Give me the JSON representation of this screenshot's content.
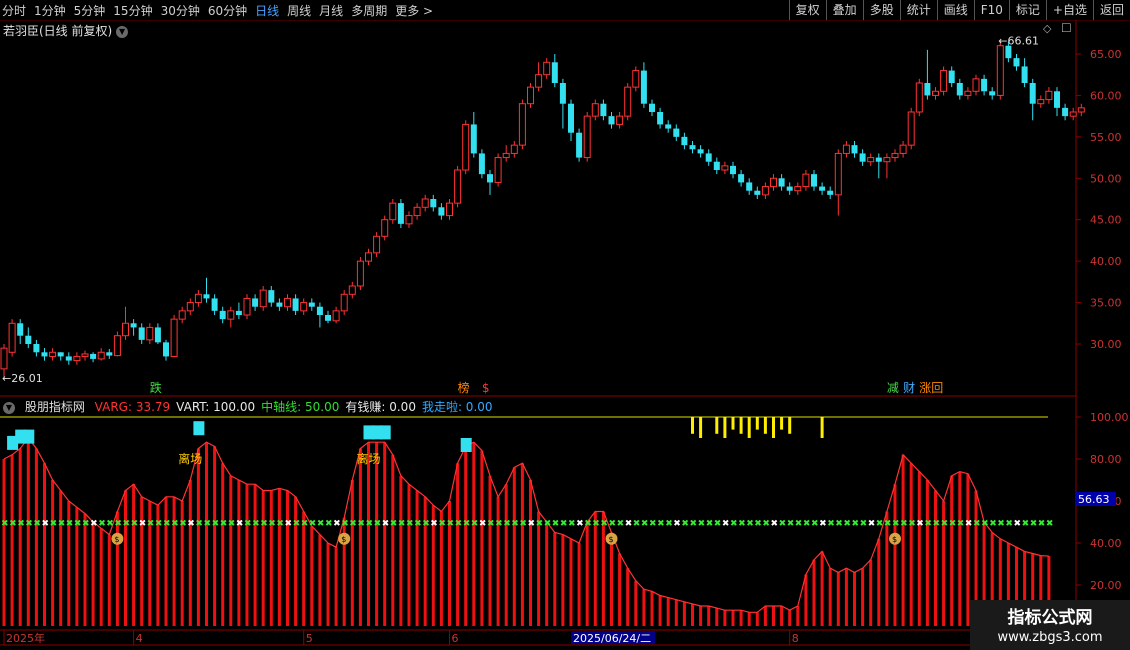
{
  "toolbar": {
    "periods": [
      "分时",
      "1分钟",
      "5分钟",
      "15分钟",
      "30分钟",
      "60分钟",
      "日线",
      "周线",
      "月线",
      "多周期",
      "更多 >"
    ],
    "active_period": "日线",
    "tools": [
      "复权",
      "叠加",
      "多股",
      "统计",
      "画线",
      "F10",
      "标记",
      "+自选",
      "返回"
    ]
  },
  "main": {
    "title": "若羽臣(日线 前复权)",
    "dropdown_icon": "chevron-down-icon",
    "price_labels": [
      "65.00",
      "60.00",
      "55.00",
      "50.00",
      "45.00",
      "40.00",
      "35.00",
      "30.00"
    ],
    "high_label": "66.61",
    "low_label": "26.01",
    "signals": [
      {
        "text": "跌",
        "color": "#44dd44",
        "col": 18
      },
      {
        "text": "榜",
        "color": "#ff8800",
        "col": 56
      },
      {
        "text": "$",
        "color": "#ff3333",
        "col": 59
      },
      {
        "text": "减",
        "color": "#44dd44",
        "col": 109
      },
      {
        "text": "财",
        "color": "#44aaff",
        "col": 111
      },
      {
        "text": "涨回",
        "color": "#ff8800",
        "col": 113
      }
    ]
  },
  "indicator": {
    "title": "股朋指标网",
    "fields": [
      {
        "label": "VARG: 33.79",
        "color": "#ff3333"
      },
      {
        "label": "VART: 100.00",
        "color": "#e8e8e8"
      },
      {
        "label": "中轴线: 50.00",
        "color": "#33dd33"
      },
      {
        "label": "有钱赚: 0.00",
        "color": "#e8e8e8"
      },
      {
        "label": "我走啦: 0.00",
        "color": "#33aaff"
      }
    ],
    "axis_labels": [
      "100.00",
      "80.00",
      "60.00",
      "40.00",
      "20.00"
    ],
    "current_value": "56.63",
    "exit_label": "离场",
    "exit_cols": [
      23,
      45
    ],
    "money_cols": [
      14,
      42,
      75,
      110
    ]
  },
  "date_axis": {
    "labels": [
      {
        "text": "2025年",
        "col": 0
      },
      {
        "text": "4",
        "col": 16
      },
      {
        "text": "5",
        "col": 37
      },
      {
        "text": "6",
        "col": 55
      },
      {
        "text": "8",
        "col": 97
      }
    ],
    "cursor_date": "2025/06/24/二",
    "cursor_col": 70
  },
  "watermark": {
    "title": "指标公式网",
    "url": "www.zbgs3.com"
  },
  "chart_data": {
    "type": "candlestick",
    "title": "若羽臣(日线 前复权)",
    "price_range": [
      24,
      68
    ],
    "candles": [
      {
        "o": 27,
        "c": 29.5,
        "h": 30,
        "l": 26
      },
      {
        "o": 29,
        "c": 32.5,
        "h": 33,
        "l": 28.5
      },
      {
        "o": 32.5,
        "c": 31,
        "h": 33,
        "l": 30
      },
      {
        "o": 31,
        "c": 30,
        "h": 32,
        "l": 29.5
      },
      {
        "o": 30,
        "c": 29,
        "h": 30.5,
        "l": 28.5
      },
      {
        "o": 29,
        "c": 28.5,
        "h": 29.5,
        "l": 28
      },
      {
        "o": 28.5,
        "c": 29,
        "h": 29.5,
        "l": 28
      },
      {
        "o": 29,
        "c": 28.5,
        "h": 29,
        "l": 28
      },
      {
        "o": 28.5,
        "c": 28,
        "h": 29,
        "l": 27.5
      },
      {
        "o": 28,
        "c": 28.5,
        "h": 29,
        "l": 27.5
      },
      {
        "o": 28.5,
        "c": 28.8,
        "h": 29.2,
        "l": 28
      },
      {
        "o": 28.8,
        "c": 28.2,
        "h": 29,
        "l": 27.8
      },
      {
        "o": 28.2,
        "c": 29,
        "h": 29.5,
        "l": 28
      },
      {
        "o": 29,
        "c": 28.6,
        "h": 29.4,
        "l": 28.2
      },
      {
        "o": 28.6,
        "c": 31,
        "h": 31.5,
        "l": 28.5
      },
      {
        "o": 31,
        "c": 32.5,
        "h": 34.5,
        "l": 30.5
      },
      {
        "o": 32.5,
        "c": 32,
        "h": 33,
        "l": 31
      },
      {
        "o": 32,
        "c": 30.5,
        "h": 32.5,
        "l": 30
      },
      {
        "o": 30.5,
        "c": 32,
        "h": 32.5,
        "l": 30
      },
      {
        "o": 32,
        "c": 30.2,
        "h": 32.5,
        "l": 30
      },
      {
        "o": 30.2,
        "c": 28.5,
        "h": 30.5,
        "l": 28
      },
      {
        "o": 28.5,
        "c": 33,
        "h": 33.5,
        "l": 28.5
      },
      {
        "o": 33,
        "c": 34,
        "h": 34.5,
        "l": 32.5
      },
      {
        "o": 34,
        "c": 35,
        "h": 35.5,
        "l": 33.5
      },
      {
        "o": 35,
        "c": 36,
        "h": 36.5,
        "l": 34.5
      },
      {
        "o": 36,
        "c": 35.5,
        "h": 38,
        "l": 35
      },
      {
        "o": 35.5,
        "c": 34,
        "h": 36,
        "l": 33.5
      },
      {
        "o": 34,
        "c": 33,
        "h": 34.5,
        "l": 32.5
      },
      {
        "o": 33,
        "c": 34,
        "h": 34.5,
        "l": 32
      },
      {
        "o": 34,
        "c": 33.5,
        "h": 35,
        "l": 33
      },
      {
        "o": 33.5,
        "c": 35.5,
        "h": 36,
        "l": 33
      },
      {
        "o": 35.5,
        "c": 34.5,
        "h": 36,
        "l": 34
      },
      {
        "o": 34.5,
        "c": 36.5,
        "h": 37,
        "l": 34
      },
      {
        "o": 36.5,
        "c": 35,
        "h": 37,
        "l": 34.5
      },
      {
        "o": 35,
        "c": 34.5,
        "h": 35.5,
        "l": 34
      },
      {
        "o": 34.5,
        "c": 35.5,
        "h": 36,
        "l": 34
      },
      {
        "o": 35.5,
        "c": 34,
        "h": 36,
        "l": 33.5
      },
      {
        "o": 34,
        "c": 35,
        "h": 35.5,
        "l": 33.5
      },
      {
        "o": 35,
        "c": 34.5,
        "h": 35.5,
        "l": 34
      },
      {
        "o": 34.5,
        "c": 33.5,
        "h": 35,
        "l": 32
      },
      {
        "o": 33.5,
        "c": 32.8,
        "h": 34,
        "l": 32.5
      },
      {
        "o": 32.8,
        "c": 34,
        "h": 34.5,
        "l": 32.5
      },
      {
        "o": 34,
        "c": 36,
        "h": 36.5,
        "l": 33.5
      },
      {
        "o": 36,
        "c": 37,
        "h": 37.5,
        "l": 35.5
      },
      {
        "o": 37,
        "c": 40,
        "h": 40.5,
        "l": 36.5
      },
      {
        "o": 40,
        "c": 41,
        "h": 41.5,
        "l": 39.5
      },
      {
        "o": 41,
        "c": 43,
        "h": 43.5,
        "l": 40.5
      },
      {
        "o": 43,
        "c": 45,
        "h": 45.5,
        "l": 42.5
      },
      {
        "o": 45,
        "c": 47,
        "h": 47.5,
        "l": 44.5
      },
      {
        "o": 47,
        "c": 44.5,
        "h": 47.5,
        "l": 44
      },
      {
        "o": 44.5,
        "c": 45.5,
        "h": 46,
        "l": 44
      },
      {
        "o": 45.5,
        "c": 46.5,
        "h": 47,
        "l": 45
      },
      {
        "o": 46.5,
        "c": 47.5,
        "h": 48,
        "l": 46
      },
      {
        "o": 47.5,
        "c": 46.5,
        "h": 48,
        "l": 46
      },
      {
        "o": 46.5,
        "c": 45.5,
        "h": 47,
        "l": 45
      },
      {
        "o": 45.5,
        "c": 47,
        "h": 47.5,
        "l": 45
      },
      {
        "o": 47,
        "c": 51,
        "h": 51.5,
        "l": 46.5
      },
      {
        "o": 51,
        "c": 56.5,
        "h": 57,
        "l": 50.5
      },
      {
        "o": 56.5,
        "c": 53,
        "h": 58,
        "l": 52.5
      },
      {
        "o": 53,
        "c": 50.5,
        "h": 53.5,
        "l": 50
      },
      {
        "o": 50.5,
        "c": 49.5,
        "h": 51,
        "l": 48
      },
      {
        "o": 49.5,
        "c": 52.5,
        "h": 53,
        "l": 49
      },
      {
        "o": 52.5,
        "c": 53,
        "h": 54,
        "l": 52
      },
      {
        "o": 53,
        "c": 54,
        "h": 54.5,
        "l": 52.5
      },
      {
        "o": 54,
        "c": 59,
        "h": 59.5,
        "l": 53.5
      },
      {
        "o": 59,
        "c": 61,
        "h": 61.5,
        "l": 58.5
      },
      {
        "o": 61,
        "c": 62.5,
        "h": 64,
        "l": 60.5
      },
      {
        "o": 62.5,
        "c": 64,
        "h": 64.5,
        "l": 62
      },
      {
        "o": 64,
        "c": 61.5,
        "h": 65,
        "l": 61
      },
      {
        "o": 61.5,
        "c": 59,
        "h": 62,
        "l": 56
      },
      {
        "o": 59,
        "c": 55.5,
        "h": 59.5,
        "l": 54.5
      },
      {
        "o": 55.5,
        "c": 52.5,
        "h": 56,
        "l": 52
      },
      {
        "o": 52.5,
        "c": 57.5,
        "h": 58,
        "l": 52
      },
      {
        "o": 57.5,
        "c": 59,
        "h": 59.5,
        "l": 57
      },
      {
        "o": 59,
        "c": 57.5,
        "h": 59.5,
        "l": 57
      },
      {
        "o": 57.5,
        "c": 56.5,
        "h": 58,
        "l": 56
      },
      {
        "o": 56.5,
        "c": 57.5,
        "h": 58,
        "l": 56
      },
      {
        "o": 57.5,
        "c": 61,
        "h": 61.5,
        "l": 57
      },
      {
        "o": 61,
        "c": 63,
        "h": 63.5,
        "l": 60.5
      },
      {
        "o": 63,
        "c": 59,
        "h": 64,
        "l": 58.5
      },
      {
        "o": 59,
        "c": 58,
        "h": 59.5,
        "l": 57.5
      },
      {
        "o": 58,
        "c": 56.5,
        "h": 58.5,
        "l": 56
      },
      {
        "o": 56.5,
        "c": 56,
        "h": 57,
        "l": 55.5
      },
      {
        "o": 56,
        "c": 55,
        "h": 56.5,
        "l": 54.5
      },
      {
        "o": 55,
        "c": 54,
        "h": 55.5,
        "l": 53.5
      },
      {
        "o": 54,
        "c": 53.5,
        "h": 54.5,
        "l": 53
      },
      {
        "o": 53.5,
        "c": 53,
        "h": 54,
        "l": 52.5
      },
      {
        "o": 53,
        "c": 52,
        "h": 53.5,
        "l": 51.5
      },
      {
        "o": 52,
        "c": 51,
        "h": 52.5,
        "l": 50.5
      },
      {
        "o": 51,
        "c": 51.5,
        "h": 52,
        "l": 50.5
      },
      {
        "o": 51.5,
        "c": 50.5,
        "h": 52,
        "l": 50
      },
      {
        "o": 50.5,
        "c": 49.5,
        "h": 51,
        "l": 49
      },
      {
        "o": 49.5,
        "c": 48.5,
        "h": 50,
        "l": 48
      },
      {
        "o": 48.5,
        "c": 48,
        "h": 49,
        "l": 47.5
      },
      {
        "o": 48,
        "c": 49,
        "h": 49.5,
        "l": 47.5
      },
      {
        "o": 49,
        "c": 50,
        "h": 50.5,
        "l": 48.5
      },
      {
        "o": 50,
        "c": 49,
        "h": 50.5,
        "l": 48.5
      },
      {
        "o": 49,
        "c": 48.5,
        "h": 49.5,
        "l": 48
      },
      {
        "o": 48.5,
        "c": 49,
        "h": 49.5,
        "l": 48
      },
      {
        "o": 49,
        "c": 50.5,
        "h": 51,
        "l": 48.5
      },
      {
        "o": 50.5,
        "c": 49,
        "h": 51,
        "l": 48.5
      },
      {
        "o": 49,
        "c": 48.5,
        "h": 49.5,
        "l": 48
      },
      {
        "o": 48.5,
        "c": 48,
        "h": 49,
        "l": 47.5
      },
      {
        "o": 48,
        "c": 53,
        "h": 53.5,
        "l": 45.5
      },
      {
        "o": 53,
        "c": 54,
        "h": 54.5,
        "l": 52.5
      },
      {
        "o": 54,
        "c": 53,
        "h": 54.5,
        "l": 52.5
      },
      {
        "o": 53,
        "c": 52,
        "h": 53.5,
        "l": 51.5
      },
      {
        "o": 52,
        "c": 52.5,
        "h": 53,
        "l": 51.5
      },
      {
        "o": 52.5,
        "c": 52,
        "h": 53,
        "l": 50
      },
      {
        "o": 52,
        "c": 52.5,
        "h": 53,
        "l": 50
      },
      {
        "o": 52.5,
        "c": 53,
        "h": 53.5,
        "l": 52
      },
      {
        "o": 53,
        "c": 54,
        "h": 54.5,
        "l": 52.5
      },
      {
        "o": 54,
        "c": 58,
        "h": 58.5,
        "l": 53.5
      },
      {
        "o": 58,
        "c": 61.5,
        "h": 62,
        "l": 57.5
      },
      {
        "o": 61.5,
        "c": 60,
        "h": 65.5,
        "l": 59.5
      },
      {
        "o": 60,
        "c": 60.5,
        "h": 61,
        "l": 59.5
      },
      {
        "o": 60.5,
        "c": 63,
        "h": 63.5,
        "l": 60
      },
      {
        "o": 63,
        "c": 61.5,
        "h": 63.5,
        "l": 61
      },
      {
        "o": 61.5,
        "c": 60,
        "h": 62,
        "l": 59.5
      },
      {
        "o": 60,
        "c": 60.5,
        "h": 61,
        "l": 59.5
      },
      {
        "o": 60.5,
        "c": 62,
        "h": 62.5,
        "l": 60
      },
      {
        "o": 62,
        "c": 60.5,
        "h": 62.5,
        "l": 60
      },
      {
        "o": 60.5,
        "c": 60,
        "h": 61,
        "l": 59.5
      },
      {
        "o": 60,
        "c": 66,
        "h": 66.61,
        "l": 59.5
      },
      {
        "o": 66,
        "c": 64.5,
        "h": 66.5,
        "l": 64
      },
      {
        "o": 64.5,
        "c": 63.5,
        "h": 65,
        "l": 63
      },
      {
        "o": 63.5,
        "c": 61.5,
        "h": 64.5,
        "l": 61
      },
      {
        "o": 61.5,
        "c": 59,
        "h": 62,
        "l": 57
      },
      {
        "o": 59,
        "c": 59.5,
        "h": 60,
        "l": 58.5
      },
      {
        "o": 59.5,
        "c": 60.5,
        "h": 61,
        "l": 59
      },
      {
        "o": 60.5,
        "c": 58.5,
        "h": 61,
        "l": 57.5
      },
      {
        "o": 58.5,
        "c": 57.5,
        "h": 59,
        "l": 57
      },
      {
        "o": 57.5,
        "c": 58,
        "h": 58.5,
        "l": 57
      },
      {
        "o": 58,
        "c": 58.5,
        "h": 59,
        "l": 57.5
      }
    ],
    "indicator_values": [
      80,
      82,
      85,
      90,
      85,
      78,
      70,
      65,
      60,
      57,
      54,
      50,
      47,
      44,
      55,
      65,
      68,
      62,
      60,
      58,
      62,
      62,
      60,
      70,
      85,
      88,
      86,
      78,
      72,
      70,
      68,
      68,
      65,
      65,
      66,
      65,
      62,
      55,
      48,
      44,
      40,
      38,
      52,
      70,
      85,
      88,
      88,
      88,
      82,
      72,
      68,
      65,
      62,
      58,
      55,
      60,
      78,
      86,
      88,
      84,
      72,
      62,
      68,
      76,
      78,
      70,
      55,
      50,
      45,
      44,
      42,
      40,
      50,
      55,
      55,
      45,
      35,
      28,
      22,
      18,
      17,
      15,
      14,
      13,
      12,
      11,
      10,
      10,
      9,
      8,
      8,
      8,
      7,
      7,
      10,
      10,
      10,
      8,
      10,
      25,
      32,
      36,
      28,
      26,
      28,
      26,
      28,
      32,
      42,
      55,
      68,
      82,
      78,
      74,
      70,
      65,
      60,
      72,
      74,
      73,
      65,
      50,
      45,
      42,
      40,
      38,
      36,
      35,
      34,
      33.79
    ],
    "midline": 50,
    "vart": 100
  }
}
